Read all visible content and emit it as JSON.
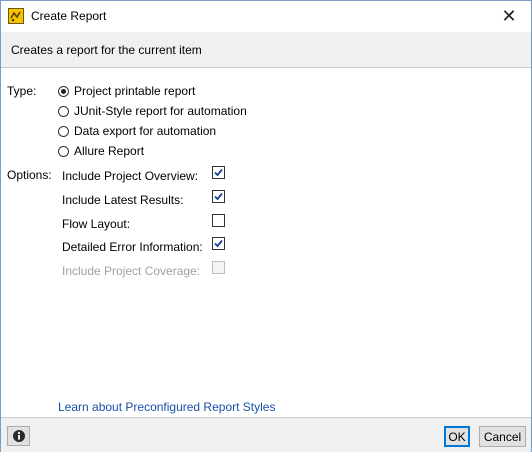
{
  "window": {
    "title": "Create Report",
    "subtitle": "Creates a report for the current item"
  },
  "type_section": {
    "label": "Type:",
    "selected": "Project printable report",
    "options": [
      "Project printable report",
      "JUnit-Style report for automation",
      "Data export for automation",
      "Allure Report"
    ]
  },
  "options_section": {
    "label": "Options:",
    "items": [
      {
        "label": "Include Project Overview:",
        "checked": true,
        "enabled": true
      },
      {
        "label": "Include Latest Results:",
        "checked": true,
        "enabled": true
      },
      {
        "label": "Flow Layout:",
        "checked": false,
        "enabled": true
      },
      {
        "label": "Detailed Error Information:",
        "checked": true,
        "enabled": true
      },
      {
        "label": "Include Project Coverage:",
        "checked": false,
        "enabled": false
      }
    ]
  },
  "link": {
    "text": "Learn about Preconfigured Report Styles"
  },
  "footer": {
    "ok_label": "OK",
    "cancel_label": "Cancel"
  },
  "icons": {
    "app": "report-app-icon",
    "close": "close-icon",
    "info": "info-icon"
  },
  "colors": {
    "link": "#1a4fa8",
    "focus_border": "#0078d7",
    "disabled_text": "#a0a0a0"
  }
}
